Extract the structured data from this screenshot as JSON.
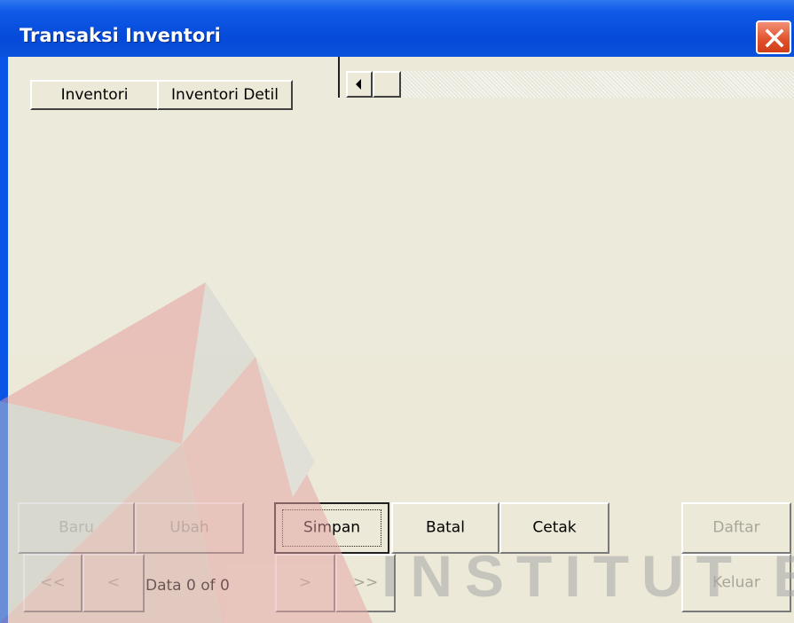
{
  "window": {
    "title": "Transaksi Inventori"
  },
  "tabs": [
    {
      "label": "Inventori"
    },
    {
      "label": "Inventori Detil"
    }
  ],
  "actions": {
    "baru": "Baru",
    "ubah": "Ubah",
    "simpan": "Simpan",
    "batal": "Batal",
    "cetak": "Cetak",
    "daftar": "Daftar",
    "keluar": "Keluar"
  },
  "navigation": {
    "first": "<<",
    "prev": "<",
    "record_label": "Data 0 of 0",
    "next": ">",
    "last": ">>"
  },
  "watermark_text": "INSTITUT BISNIS & INFORMATIKA",
  "colors": {
    "titlebar": "#0a55e6",
    "client": "#ece9d8",
    "close_button": "#e0512b"
  }
}
